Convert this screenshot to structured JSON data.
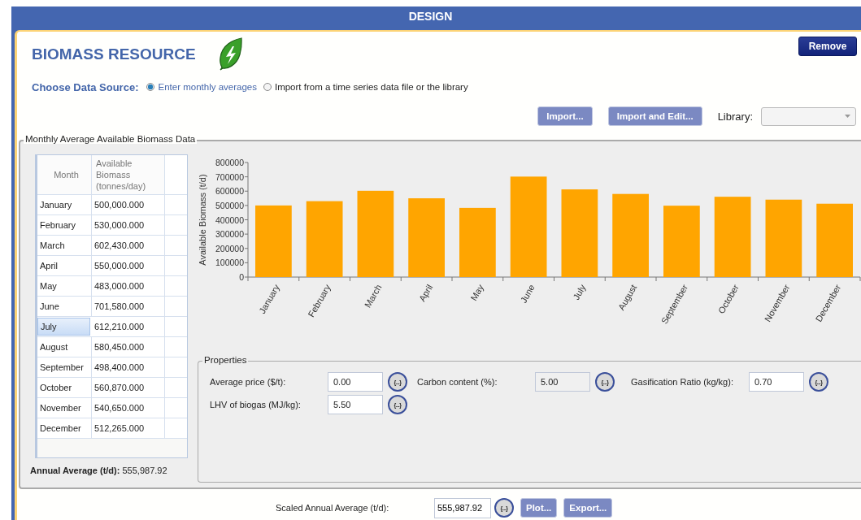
{
  "header": {
    "title": "DESIGN"
  },
  "page": {
    "title": "BIOMASS RESOURCE",
    "remove_button": {
      "label": "Remove",
      "disabled": false
    }
  },
  "data_source": {
    "label": "Choose Data Source:",
    "options": [
      {
        "label": "Enter monthly averages",
        "selected": true
      },
      {
        "label": "Import from a time series data file or the library",
        "selected": false
      }
    ]
  },
  "import_buttons": [
    {
      "label": "Import...",
      "disabled": true
    },
    {
      "label": "Import and Edit...",
      "disabled": true
    }
  ],
  "library": {
    "label": "Library:"
  },
  "monthly_group": {
    "title": "Monthly Average Available Biomass Data",
    "table": {
      "columns": [
        "Month",
        "Available Biomass (tonnes/day)"
      ],
      "rows": [
        {
          "month": "January",
          "value": "500,000.000",
          "selected": false
        },
        {
          "month": "February",
          "value": "530,000.000",
          "selected": false
        },
        {
          "month": "March",
          "value": "602,430.000",
          "selected": false
        },
        {
          "month": "April",
          "value": "550,000.000",
          "selected": false
        },
        {
          "month": "May",
          "value": "483,000.000",
          "selected": false
        },
        {
          "month": "June",
          "value": "701,580.000",
          "selected": false
        },
        {
          "month": "July",
          "value": "612,210.000",
          "selected": true
        },
        {
          "month": "August",
          "value": "580,450.000",
          "selected": false
        },
        {
          "month": "September",
          "value": "498,400.000",
          "selected": false
        },
        {
          "month": "October",
          "value": "560,870.000",
          "selected": false
        },
        {
          "month": "November",
          "value": "540,650.000",
          "selected": false
        },
        {
          "month": "December",
          "value": "512,265.000",
          "selected": false
        }
      ]
    },
    "annual_average": {
      "label": "Annual Average (t/d):",
      "value": "555,987.92"
    },
    "chart_data": {
      "type": "bar",
      "ylabel": "Available Biomass (t/d)",
      "categories": [
        "January",
        "February",
        "March",
        "April",
        "May",
        "June",
        "July",
        "August",
        "September",
        "October",
        "November",
        "December"
      ],
      "values": [
        500000,
        530000,
        602430,
        550000,
        483000,
        701580,
        612210,
        580450,
        498400,
        560870,
        540650,
        512265
      ],
      "ylim": [
        0,
        800000
      ],
      "yticks": [
        0,
        100000,
        200000,
        300000,
        400000,
        500000,
        600000,
        700000,
        800000
      ]
    },
    "properties": {
      "title": "Properties",
      "fields": [
        {
          "label": "Average price ($/t):",
          "value": "0.00",
          "disabled": false,
          "button": "{...}"
        },
        {
          "label": "Carbon content (%):",
          "value": "5.00",
          "disabled": true,
          "button": "{...}"
        },
        {
          "label": "Gasification Ratio (kg/kg):",
          "value": "0.70",
          "disabled": false,
          "button": "{...}"
        },
        {
          "label": "LHV of biogas (MJ/kg):",
          "value": "5.50",
          "disabled": false,
          "button": "{...}"
        }
      ]
    }
  },
  "scaled": {
    "label": "Scaled Annual Average (t/d):",
    "value": "555,987.92",
    "button": "{...}",
    "buttons": [
      {
        "label": "Plot...",
        "disabled": true
      },
      {
        "label": "Export...",
        "disabled": true
      }
    ]
  }
}
